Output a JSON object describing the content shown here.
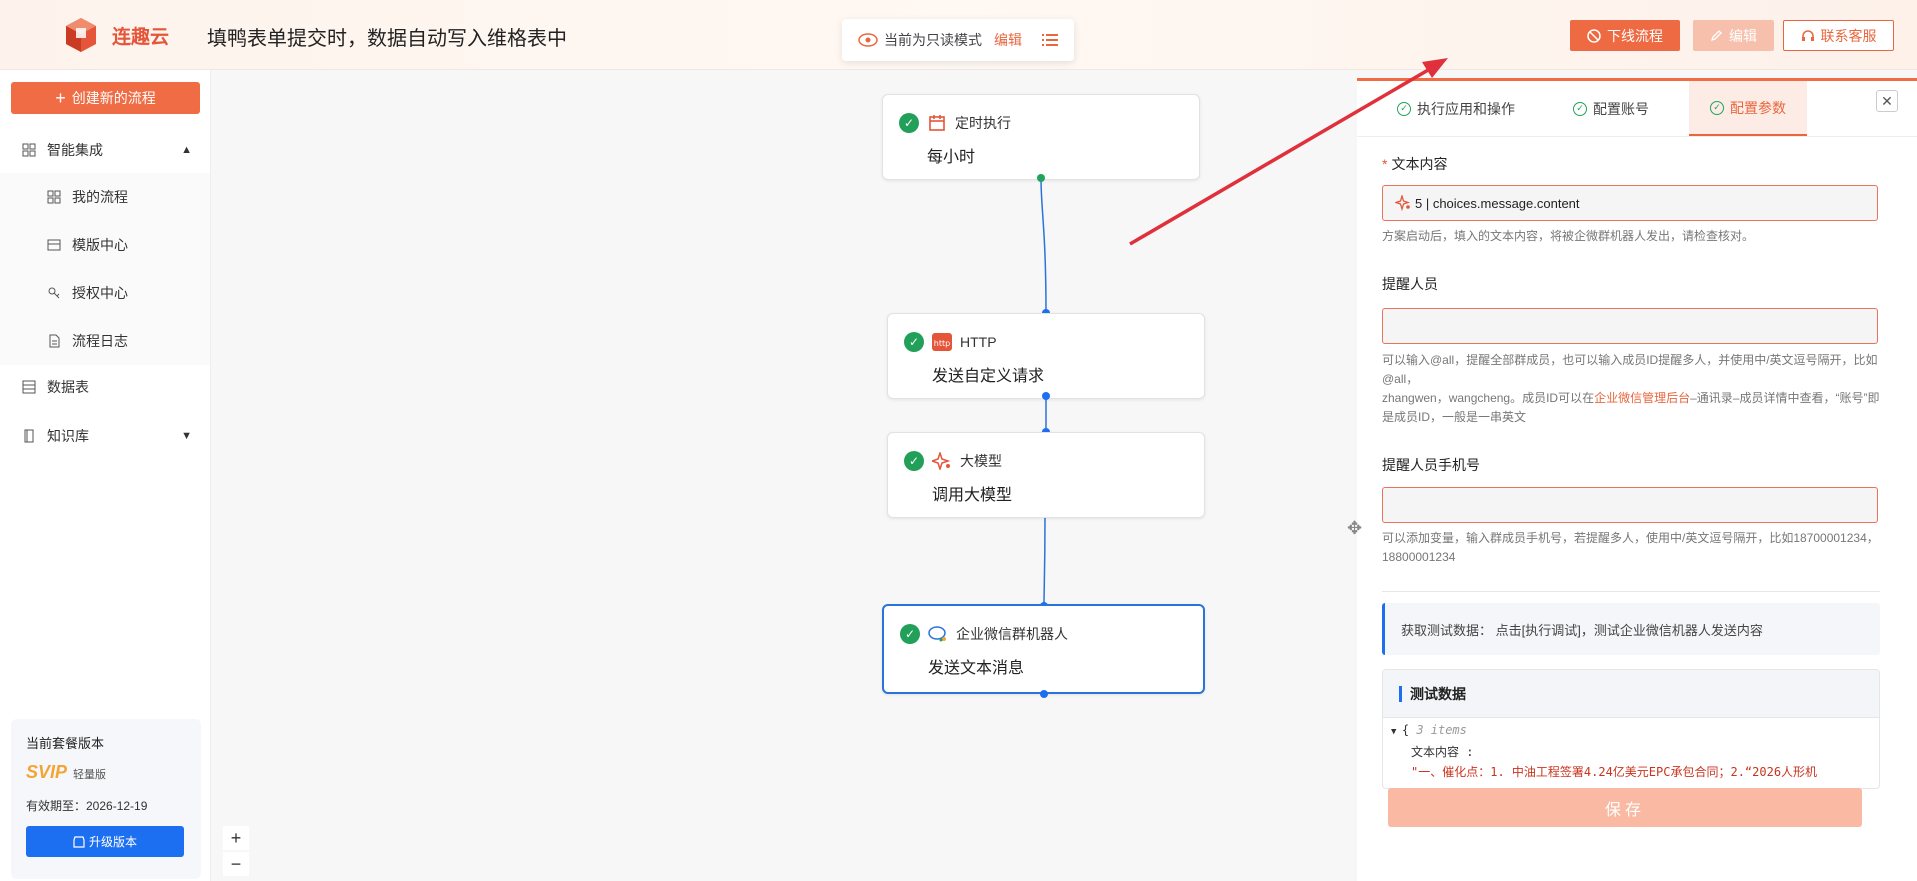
{
  "header": {
    "brand": "连趣云",
    "title": "填鸭表单提交时，数据自动写入维格表中",
    "readonly_text": "当前为只读模式",
    "readonly_edit": "编辑",
    "btn_offline": "下线流程",
    "btn_edit": "编辑",
    "btn_service": "联系客服"
  },
  "sidebar": {
    "create": "创建新的流程",
    "items": [
      {
        "label": "智能集成",
        "icon": "grid-icon",
        "expand": "▲"
      },
      {
        "label": "我的流程",
        "icon": "grid-icon"
      },
      {
        "label": "模版中心",
        "icon": "template-icon"
      },
      {
        "label": "授权中心",
        "icon": "key-icon"
      },
      {
        "label": "流程日志",
        "icon": "file-icon"
      },
      {
        "label": "数据表",
        "icon": "table-icon"
      },
      {
        "label": "知识库",
        "icon": "book-icon",
        "expand": "▼"
      }
    ],
    "plan": {
      "title": "当前套餐版本",
      "level": "SVIP",
      "edition": "轻量版",
      "expiry": "有效期至：2026-12-19",
      "upgrade": "升级版本"
    }
  },
  "canvas": {
    "nodes": [
      {
        "app": "定时执行",
        "action": "每小时",
        "icon": "calendar-icon"
      },
      {
        "app": "HTTP",
        "action": "发送自定义请求",
        "icon": "http-icon"
      },
      {
        "app": "大模型",
        "action": "调用大模型",
        "icon": "sparkle-icon"
      },
      {
        "app": "企业微信群机器人",
        "action": "发送文本消息",
        "icon": "wecom-icon"
      }
    ],
    "zoom_in": "+",
    "zoom_out": "−"
  },
  "panel": {
    "tabs": [
      "执行应用和操作",
      "配置账号",
      "配置参数"
    ],
    "active_tab": 2,
    "field1_label": "文本内容",
    "field1_value": "5 | choices.message.content",
    "field1_hint": "方案启动后，填入的文本内容，将被企微群机器人发出，请检查核对。",
    "field2_label": "提醒人员",
    "field2_hint_a": "可以输入@all，提醒全部群成员，也可以输入成员ID提醒多人，并使用中/英文逗号隔开，比如@all，",
    "field2_hint_b": "zhangwen，wangcheng。成员ID可以在",
    "field2_hint_link": "企业微信管理后台",
    "field2_hint_c": "–通讯录–成员详情中查看，“账号”即是成员ID，一般是一串英文",
    "field3_label": "提醒人员手机号",
    "field3_hint": "可以添加变量，输入群成员手机号，若提醒多人，使用中/英文逗号隔开，比如18700001234，18800001234",
    "tip": "获取测试数据： 点击[执行调试]，测试企业微信机器人发送内容",
    "test_title": "测试数据",
    "json_open": "{",
    "json_count": "3 items",
    "json_key": "文本内容 :",
    "json_value": "\"一、催化点：1. 中油工程签署4.24亿美元EPC承包合同；2.“2026人形机",
    "save": "保存"
  }
}
